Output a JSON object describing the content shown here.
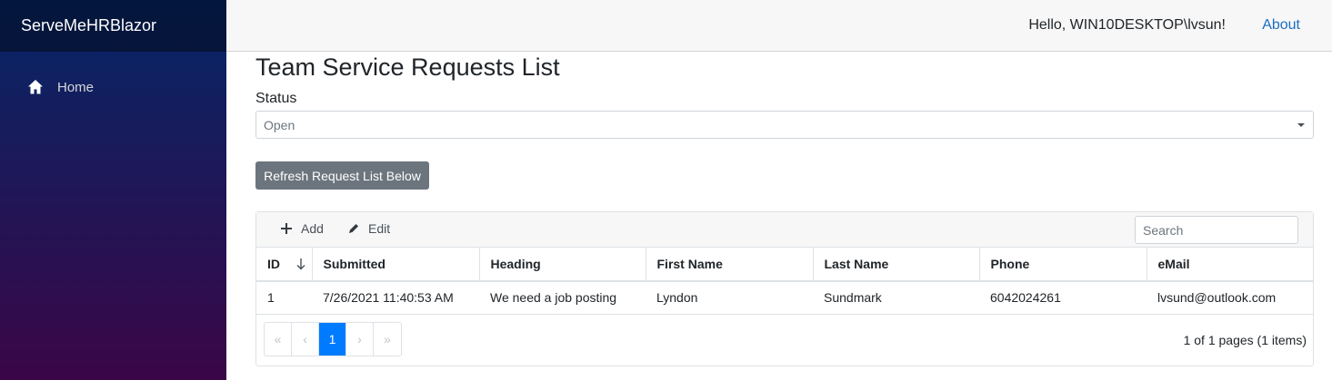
{
  "app": {
    "brand": "ServeMeHRBlazor"
  },
  "sidebar": {
    "items": [
      {
        "label": "Home",
        "icon": "home-icon"
      }
    ]
  },
  "topbar": {
    "hello": "Hello, WIN10DESKTOP\\lvsun!",
    "about": "About"
  },
  "page": {
    "title": "Team Service Requests List",
    "status_label": "Status",
    "status_value": "Open",
    "refresh_label": "Refresh Request List Below"
  },
  "grid": {
    "toolbar": {
      "add_label": "Add",
      "edit_label": "Edit",
      "search_placeholder": "Search"
    },
    "columns": [
      "ID",
      "Submitted",
      "Heading",
      "First Name",
      "Last Name",
      "Phone",
      "eMail"
    ],
    "rows": [
      {
        "id": "1",
        "submitted": "7/26/2021 11:40:53 AM",
        "heading": "We need a job posting",
        "first_name": "Lyndon",
        "last_name": "Sundmark",
        "phone": "6042024261",
        "email": "lvsund@outlook.com"
      }
    ],
    "pager": {
      "first": "«",
      "prev": "‹",
      "current": "1",
      "next": "›",
      "last": "»",
      "info": "1 of 1 pages (1 items)"
    }
  },
  "colors": {
    "accent": "#007bff",
    "link": "#1b6ec2",
    "button": "#6c757d"
  }
}
